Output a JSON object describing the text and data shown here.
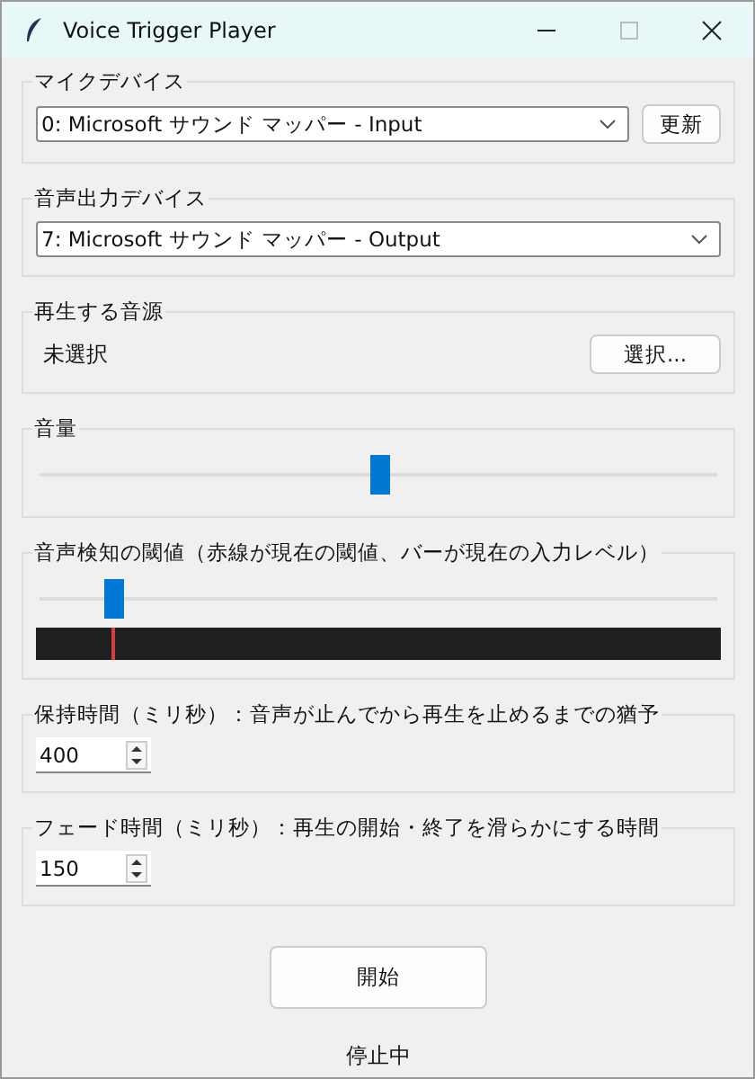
{
  "window": {
    "title": "Voice Trigger Player"
  },
  "mic": {
    "label": "マイクデバイス",
    "value": "0: Microsoft サウンド マッパー - Input",
    "button": "更新"
  },
  "output": {
    "label": "音声出力デバイス",
    "value": "7: Microsoft サウンド マッパー - Output"
  },
  "source": {
    "label": "再生する音源",
    "value": "未選択",
    "button": "選択..."
  },
  "volume": {
    "label": "音量",
    "level": 0.5
  },
  "threshold": {
    "label": "音声検知の閾値（赤線が現在の閾値、バーが現在の入力レベル）",
    "level": 0.11,
    "meter": {
      "level": 0
    }
  },
  "spinners": [
    {
      "label": "保持時間（ミリ秒）：音声が止んでから再生を止めるまでの猶予",
      "value": "400"
    },
    {
      "label": "フェード時間（ミリ秒）：再生の開始・終了を滑らかにする時間",
      "value": "150"
    }
  ],
  "start_button": "開始",
  "status": "停止中"
}
